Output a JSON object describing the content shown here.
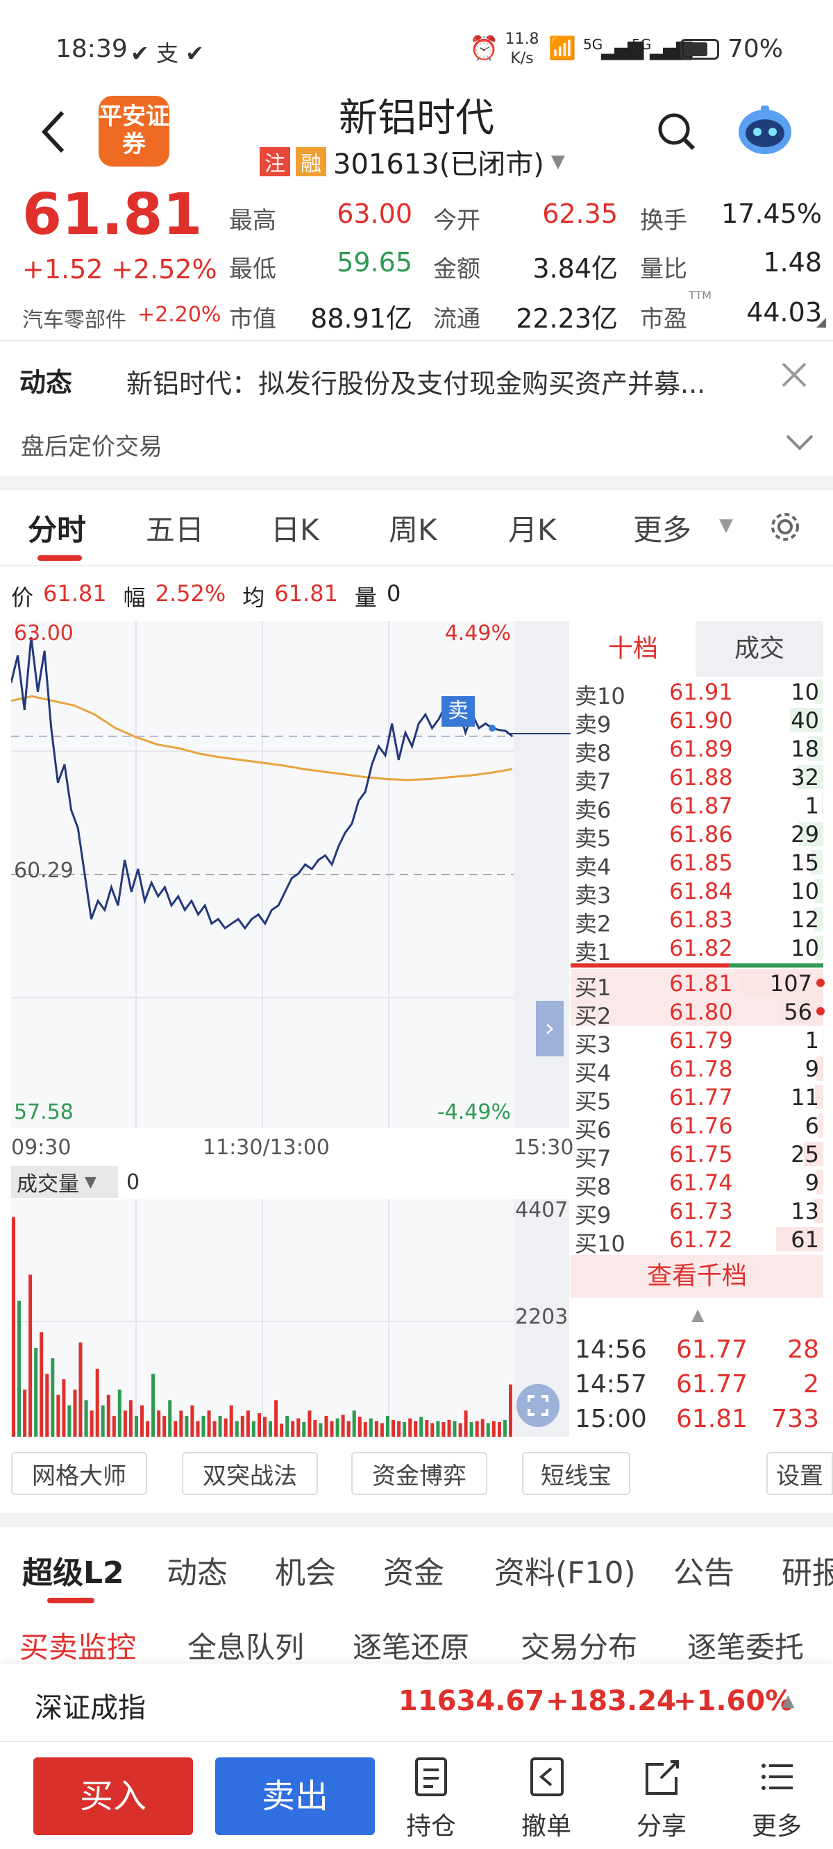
{
  "status_bar": {
    "time": "18:39",
    "net_speed_value": "11.8",
    "net_speed_unit": "K/s",
    "battery": "70%",
    "signal1": "5G",
    "signal2": "5G"
  },
  "header": {
    "back_icon": "back-arrow-icon",
    "broker_logo_text": "平安证券",
    "title": "新铝时代",
    "tag1": "注",
    "tag2": "融",
    "code_status": "301613(已闭市)",
    "search_icon": "search-icon",
    "assistant_icon": "robot-icon"
  },
  "quote": {
    "price": "61.81",
    "change": "+1.52",
    "change_pct": "+2.52%",
    "sector": "汽车零部件",
    "sector_pct": "+2.20%",
    "fields": [
      {
        "label": "最高",
        "value": "63.00",
        "color": "red"
      },
      {
        "label": "今开",
        "value": "62.35",
        "color": "red"
      },
      {
        "label": "换手",
        "value": "17.45%",
        "color": "dark"
      },
      {
        "label": "最低",
        "value": "59.65",
        "color": "green"
      },
      {
        "label": "金额",
        "value": "3.84亿",
        "color": "dark"
      },
      {
        "label": "量比",
        "value": "1.48",
        "color": "dark"
      },
      {
        "label": "市值",
        "value": "88.91亿",
        "color": "dark"
      },
      {
        "label": "流通",
        "value": "22.23亿",
        "color": "dark"
      },
      {
        "label": "市盈",
        "value": "44.03",
        "color": "dark"
      }
    ],
    "pe_sup": "TTM"
  },
  "news": {
    "label": "动态",
    "text": "新铝时代：拟发行股份及支付现金购买资产并募...",
    "close_icon": "close-icon"
  },
  "after_hours": {
    "label": "盘后定价交易",
    "chevron": "chevron-down-icon"
  },
  "chart_tabs": [
    "分时",
    "五日",
    "日K",
    "周K",
    "月K",
    "更多"
  ],
  "chart_info": {
    "price_label": "价",
    "price": "61.81",
    "amp_label": "幅",
    "amp": "2.52%",
    "avg_label": "均",
    "avg": "61.81",
    "vol_label": "量",
    "vol": "0"
  },
  "chart_data": [
    {
      "type": "line",
      "x_labels": [
        "09:30",
        "11:30/13:00",
        "15:30"
      ],
      "y_left_labels": [
        "63.00",
        "60.29",
        "57.58"
      ],
      "y_right_labels": [
        "4.49%",
        "-4.49%"
      ],
      "ylim": [
        57.58,
        63.0
      ],
      "prev_close": 60.29,
      "marker": "卖",
      "series": [
        {
          "values": [
            62.4,
            62.7,
            62.1,
            62.9,
            62.3,
            62.75,
            61.9,
            61.3,
            61.5,
            61.0,
            60.8,
            60.3,
            59.8,
            60.0,
            59.9,
            60.15,
            59.95,
            60.45,
            60.1,
            60.35,
            60.0,
            60.2,
            60.05,
            60.15,
            59.95,
            60.05,
            59.9,
            60.0,
            59.85,
            59.95,
            59.75,
            59.8,
            59.7,
            59.75,
            59.8,
            59.7,
            59.8,
            59.85,
            59.75,
            59.9,
            59.95,
            60.1,
            60.25,
            60.3,
            60.4,
            60.35,
            60.45,
            60.5,
            60.4,
            60.6,
            60.75,
            60.85,
            61.1,
            61.2,
            61.5,
            61.7,
            61.6,
            61.95,
            61.55,
            61.85,
            61.7,
            61.95,
            62.05,
            61.9,
            62.0,
            62.15,
            61.95,
            62.1,
            61.85,
            62.05,
            61.9,
            61.95,
            61.9,
            61.88,
            61.87,
            61.81
          ]
        },
        {
          "values": [
            62.2,
            62.25,
            62.2,
            62.15,
            62.05,
            61.9,
            61.8,
            61.72,
            61.68,
            61.62,
            61.58,
            61.55,
            61.52,
            61.49,
            61.45,
            61.42,
            61.39,
            61.36,
            61.34,
            61.33,
            61.34,
            61.36,
            61.38,
            61.41,
            61.45
          ]
        }
      ]
    },
    {
      "type": "bar",
      "label": "成交量",
      "value_display": "0",
      "y_labels": [
        "4407",
        "2203"
      ],
      "ylim": [
        0,
        4407
      ],
      "values": [
        4200,
        2600,
        900,
        3100,
        1700,
        2000,
        1200,
        1500,
        800,
        1100,
        600,
        900,
        1800,
        700,
        500,
        1300,
        600,
        800,
        400,
        900,
        500,
        700,
        400,
        600,
        300,
        1200,
        500,
        400,
        700,
        300,
        500,
        400,
        600,
        300,
        400,
        500,
        300,
        400,
        350,
        600,
        300,
        400,
        500,
        300,
        450,
        380,
        300,
        700,
        250,
        400,
        300,
        350,
        280,
        500,
        320,
        260,
        400,
        300,
        350,
        420,
        300,
        500,
        380,
        280,
        350,
        300,
        260,
        400,
        320,
        300,
        280,
        350,
        300,
        380,
        320,
        260,
        300,
        280,
        320,
        300,
        260,
        500,
        280,
        300,
        340,
        260,
        300,
        280,
        320,
        1000
      ]
    }
  ],
  "order_book": {
    "tab_active": "十档",
    "tab_other": "成交",
    "asks": [
      {
        "label": "卖10",
        "price": "61.91",
        "vol": "10",
        "bar": 0.1
      },
      {
        "label": "卖9",
        "price": "61.90",
        "vol": "40",
        "bar": 0.4
      },
      {
        "label": "卖8",
        "price": "61.89",
        "vol": "18",
        "bar": 0.18
      },
      {
        "label": "卖7",
        "price": "61.88",
        "vol": "32",
        "bar": 0.32
      },
      {
        "label": "卖6",
        "price": "61.87",
        "vol": "1",
        "bar": 0.02
      },
      {
        "label": "卖5",
        "price": "61.86",
        "vol": "29",
        "bar": 0.29
      },
      {
        "label": "卖4",
        "price": "61.85",
        "vol": "15",
        "bar": 0.15
      },
      {
        "label": "卖3",
        "price": "61.84",
        "vol": "10",
        "bar": 0.1
      },
      {
        "label": "卖2",
        "price": "61.83",
        "vol": "12",
        "bar": 0.12
      },
      {
        "label": "卖1",
        "price": "61.82",
        "vol": "10",
        "bar": 0.1
      }
    ],
    "bids": [
      {
        "label": "买1",
        "price": "61.81",
        "vol": "107",
        "bar": 1.0,
        "dot": true
      },
      {
        "label": "买2",
        "price": "61.80",
        "vol": "56",
        "bar": 0.52,
        "dot": true
      },
      {
        "label": "买3",
        "price": "61.79",
        "vol": "1",
        "bar": 0.01
      },
      {
        "label": "买4",
        "price": "61.78",
        "vol": "9",
        "bar": 0.08
      },
      {
        "label": "买5",
        "price": "61.77",
        "vol": "11",
        "bar": 0.1
      },
      {
        "label": "买6",
        "price": "61.76",
        "vol": "6",
        "bar": 0.06
      },
      {
        "label": "买7",
        "price": "61.75",
        "vol": "25",
        "bar": 0.23
      },
      {
        "label": "买8",
        "price": "61.74",
        "vol": "9",
        "bar": 0.08
      },
      {
        "label": "买9",
        "price": "61.73",
        "vol": "13",
        "bar": 0.12
      },
      {
        "label": "买10",
        "price": "61.72",
        "vol": "61",
        "bar": 0.57
      }
    ],
    "view_thousand": "查看千档",
    "trades": [
      {
        "time": "14:56",
        "price": "61.77",
        "vol": "28"
      },
      {
        "time": "14:57",
        "price": "61.77",
        "vol": "2"
      },
      {
        "time": "15:00",
        "price": "61.81",
        "vol": "733"
      }
    ]
  },
  "tools": [
    "网格大师",
    "双突战法",
    "资金博弈",
    "短线宝",
    "设置"
  ],
  "l2_tabs": [
    "超级L2",
    "动态",
    "机会",
    "资金",
    "资料(F10)",
    "公告",
    "研报"
  ],
  "sub_tabs": [
    "买卖监控",
    "全息队列",
    "逐笔还原",
    "交易分布",
    "逐笔委托"
  ],
  "index": {
    "name": "深证成指",
    "value": "11634.67",
    "change": "+183.24",
    "pct": "+1.60%"
  },
  "bottom_nav": {
    "buy": "买入",
    "sell": "卖出",
    "items": [
      {
        "label": "持仓",
        "icon": "position-icon"
      },
      {
        "label": "撤单",
        "icon": "cancel-order-icon"
      },
      {
        "label": "分享",
        "icon": "share-icon"
      },
      {
        "label": "更多",
        "icon": "more-icon"
      }
    ]
  },
  "colors": {
    "up": "#e0302c",
    "down": "#2f9a52",
    "price_line": "#223a7a",
    "avg_line": "#e8a33c",
    "sell_button": "#2f6fe0",
    "buy_button": "#d9302b"
  }
}
